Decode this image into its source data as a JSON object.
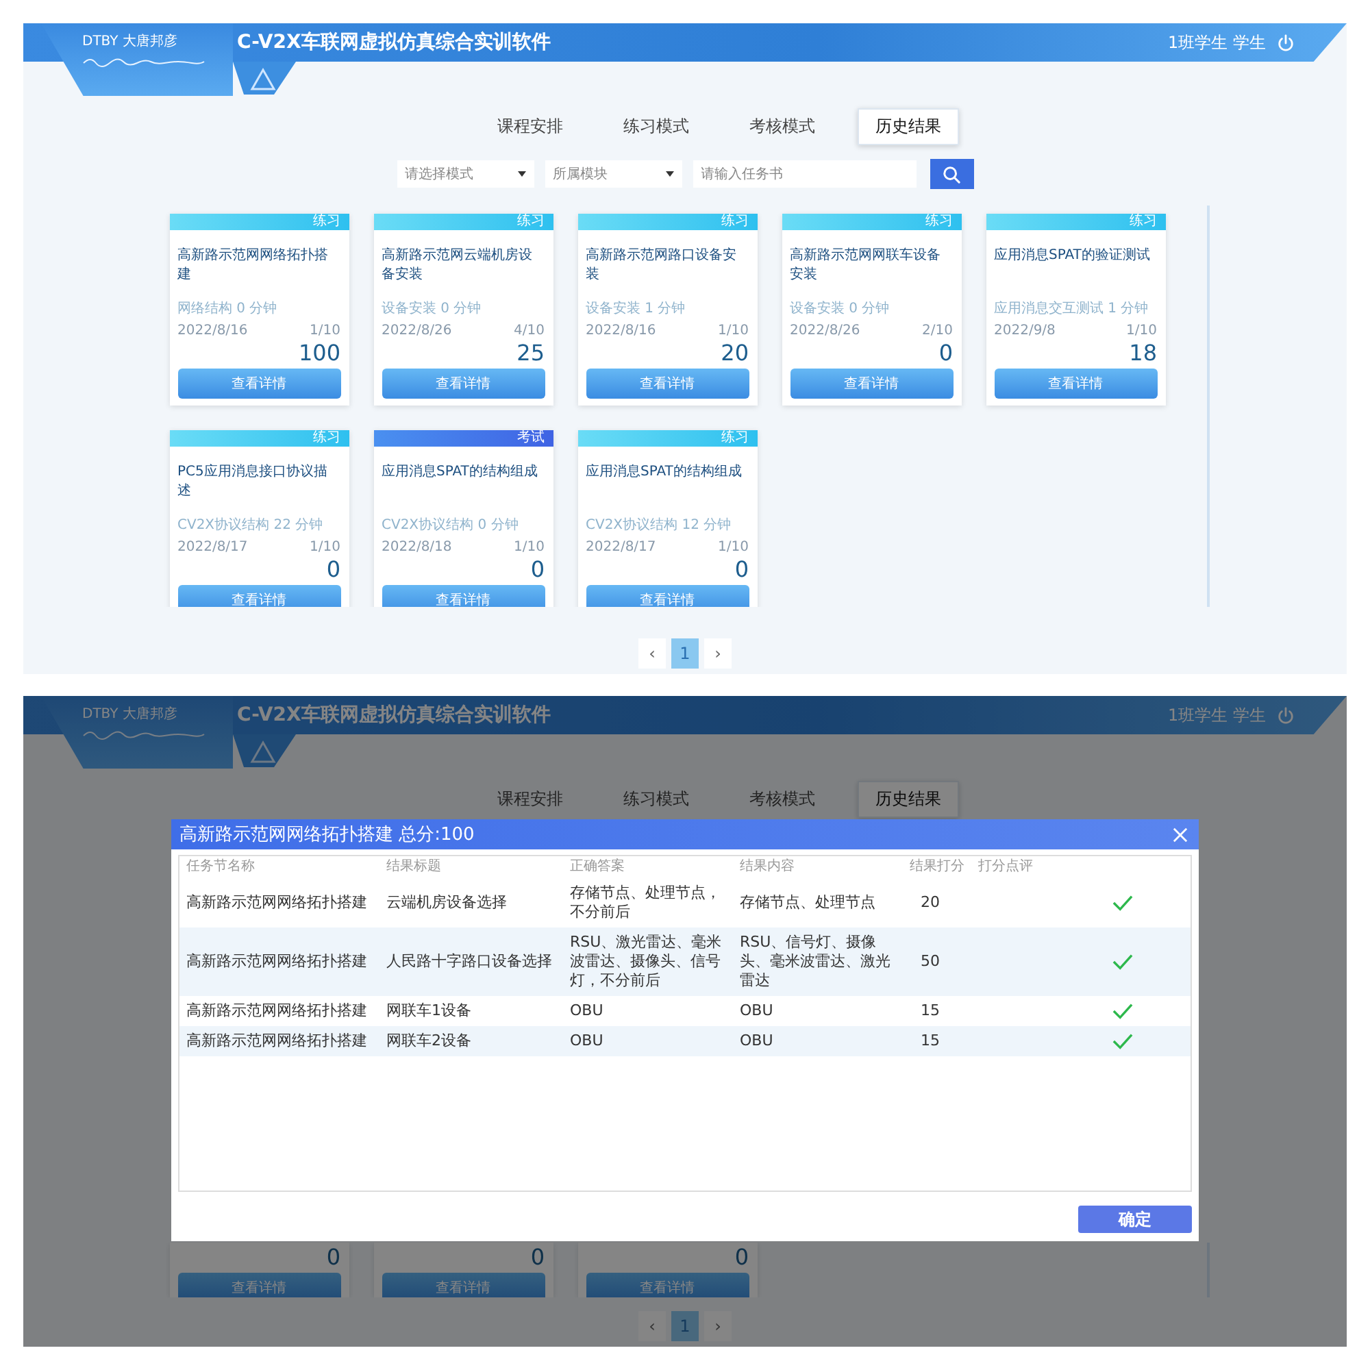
{
  "list_view": {
    "header": {
      "logo": "DTBY 大唐邦彦",
      "title": "C-V2X车联网虚拟仿真综合实训软件",
      "user": "1班学生 学生"
    },
    "tabs": [
      {
        "label": "课程安排",
        "selected": false
      },
      {
        "label": "练习模式",
        "selected": false
      },
      {
        "label": "考核模式",
        "selected": false
      },
      {
        "label": "历史结果",
        "selected": true
      }
    ],
    "filters": {
      "mode_select": "请选择模式",
      "module_select": "所属模块",
      "search": {
        "placeholder": "请输入任务书"
      }
    },
    "cards": [
      {
        "kind": "practice",
        "tag": "练习",
        "title": "高新路示范网网络拓扑搭建",
        "meta": "网络结构 0 分钟",
        "date": "2022/8/16",
        "attempts": "1/10",
        "score": "100",
        "button": "查看详情"
      },
      {
        "kind": "practice",
        "tag": "练习",
        "title": "高新路示范网云端机房设备安装",
        "meta": "设备安装 0 分钟",
        "date": "2022/8/26",
        "attempts": "4/10",
        "score": "25",
        "button": "查看详情"
      },
      {
        "kind": "practice",
        "tag": "练习",
        "title": "高新路示范网路口设备安装",
        "meta": "设备安装 1 分钟",
        "date": "2022/8/16",
        "attempts": "1/10",
        "score": "20",
        "button": "查看详情"
      },
      {
        "kind": "practice",
        "tag": "练习",
        "title": "高新路示范网网联车设备安装",
        "meta": "设备安装 0 分钟",
        "date": "2022/8/26",
        "attempts": "2/10",
        "score": "0",
        "button": "查看详情"
      },
      {
        "kind": "practice",
        "tag": "练习",
        "title": "应用消息SPAT的验证测试",
        "meta": "应用消息交互测试 1 分钟",
        "date": "2022/9/8",
        "attempts": "1/10",
        "score": "18",
        "button": "查看详情"
      },
      {
        "kind": "practice",
        "tag": "练习",
        "title": "PC5应用消息接口协议描述",
        "meta": "CV2X协议结构 22 分钟",
        "date": "2022/8/17",
        "attempts": "1/10",
        "score": "0",
        "button": "查看详情"
      },
      {
        "kind": "exam",
        "tag": "考试",
        "title": "应用消息SPAT的结构组成",
        "meta": "CV2X协议结构 0 分钟",
        "date": "2022/8/18",
        "attempts": "1/10",
        "score": "0",
        "button": "查看详情"
      },
      {
        "kind": "practice",
        "tag": "练习",
        "title": "应用消息SPAT的结构组成",
        "meta": "CV2X协议结构 12 分钟",
        "date": "2022/8/17",
        "attempts": "1/10",
        "score": "0",
        "button": "查看详情"
      }
    ],
    "pagination": {
      "prev": "‹",
      "pages": [
        {
          "label": "1",
          "selected": true
        }
      ],
      "next": "›"
    }
  },
  "dialog_view": {
    "header": {
      "logo": "DTBY 大唐邦彦",
      "title": "C-V2X车联网虚拟仿真综合实训软件",
      "user": "1班学生 学生"
    },
    "tabs": [
      {
        "label": "课程安排",
        "selected": false
      },
      {
        "label": "练习模式",
        "selected": false
      },
      {
        "label": "考核模式",
        "selected": false
      },
      {
        "label": "历史结果",
        "selected": true
      }
    ],
    "cards": [
      {
        "score": "0",
        "button": "查看详情"
      },
      {
        "score": "0",
        "button": "查看详情"
      },
      {
        "score": "0",
        "button": "查看详情"
      }
    ],
    "pagination": {
      "prev": "‹",
      "pages": [
        {
          "label": "1",
          "selected": true
        }
      ],
      "next": "›"
    },
    "dialog": {
      "title": "高新路示范网网络拓扑搭建 总分:100",
      "table": {
        "columns": [
          "任务节名称",
          "结果标题",
          "正确答案",
          "结果内容",
          "结果打分",
          "打分点评"
        ],
        "rows": [
          {
            "cells": [
              "高新路示范网网络拓扑搭建",
              "云端机房设备选择",
              "存储节点、处理节点，不分前后",
              "存储节点、处理节点",
              "20",
              ""
            ],
            "correct": true
          },
          {
            "cells": [
              "高新路示范网网络拓扑搭建",
              "人民路十字路口设备选择",
              "RSU、激光雷达、毫米波雷达、摄像头、信号灯，不分前后",
              "RSU、信号灯、摄像头、毫米波雷达、激光雷达",
              "50",
              ""
            ],
            "correct": true
          },
          {
            "cells": [
              "高新路示范网网络拓扑搭建",
              "网联车1设备",
              "OBU",
              "OBU",
              "15",
              ""
            ],
            "correct": true
          },
          {
            "cells": [
              "高新路示范网网络拓扑搭建",
              "网联车2设备",
              "OBU",
              "OBU",
              "15",
              ""
            ],
            "correct": true
          }
        ]
      },
      "confirm": "确定"
    }
  }
}
